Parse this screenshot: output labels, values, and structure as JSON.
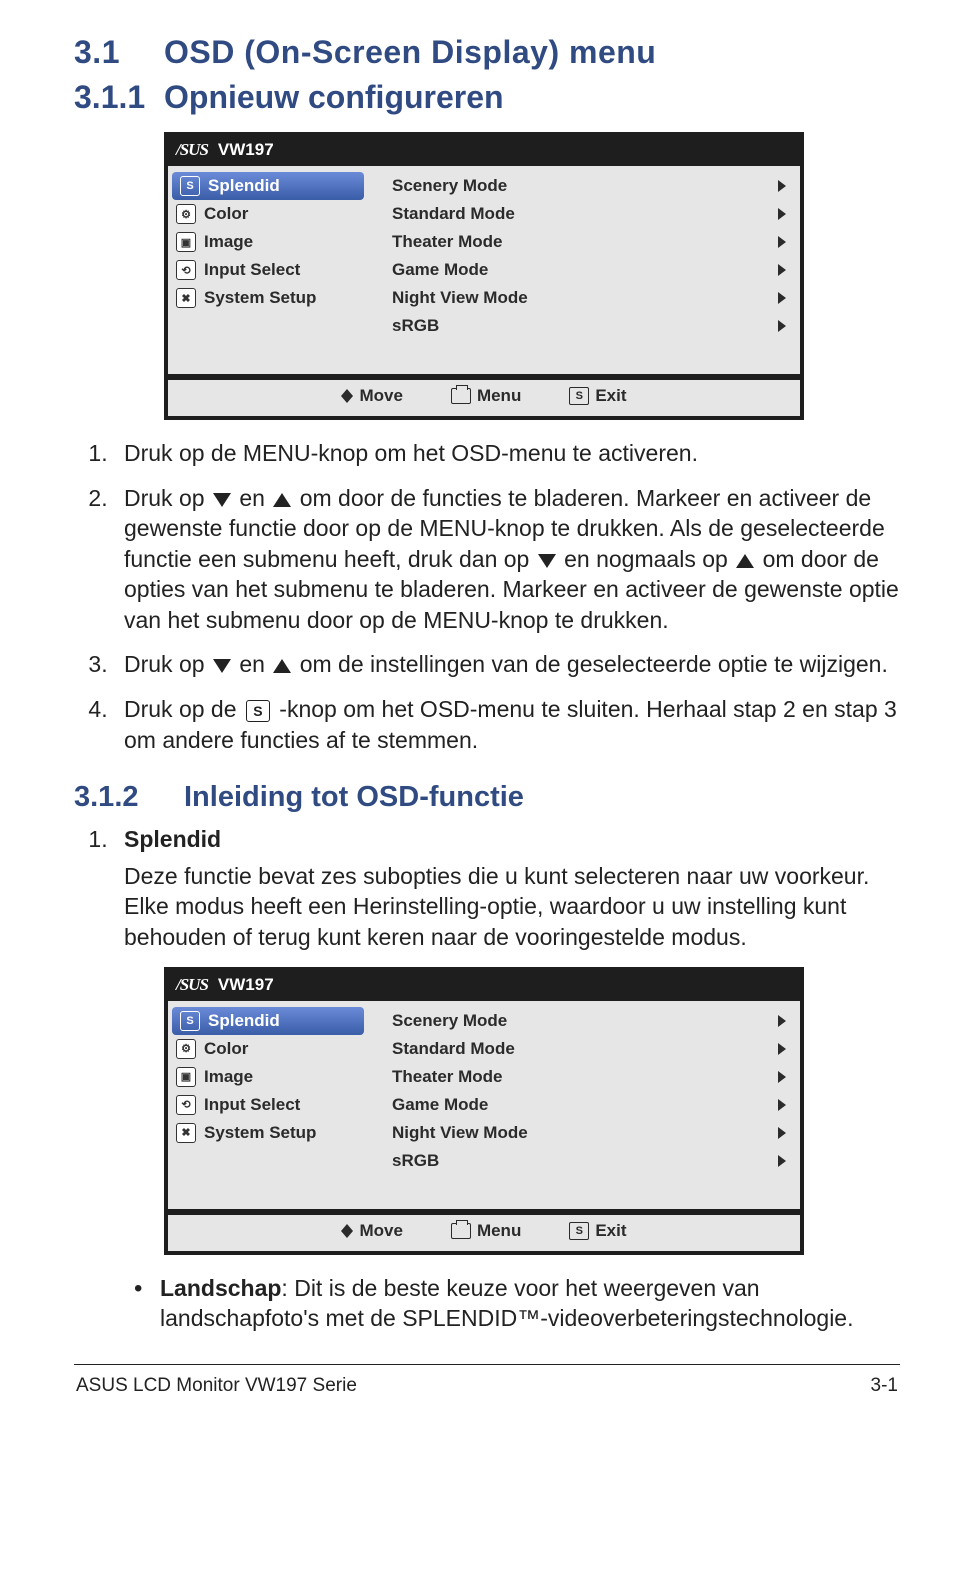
{
  "headings": {
    "h31_num": "3.1",
    "h31_title": "OSD (On-Screen Display) menu",
    "h311_num": "3.1.1",
    "h311_title": "Opnieuw configureren",
    "h312_num": "3.1.2",
    "h312_title": "Inleiding tot OSD-functie"
  },
  "osd": {
    "brand": "/SUS",
    "model": "VW197",
    "leftItems": [
      {
        "icon": "S",
        "label": "Splendid"
      },
      {
        "icon": "⚙",
        "label": "Color"
      },
      {
        "icon": "▣",
        "label": "Image"
      },
      {
        "icon": "⟲",
        "label": "Input Select"
      },
      {
        "icon": "✖",
        "label": "System Setup"
      }
    ],
    "modes": [
      "Scenery Mode",
      "Standard Mode",
      "Theater Mode",
      "Game Mode",
      "Night View Mode",
      "sRGB"
    ],
    "bottom": {
      "move": "Move",
      "menu": "Menu",
      "exit": "Exit"
    }
  },
  "steps": {
    "s1": "Druk op de MENU-knop om het OSD-menu te activeren.",
    "s2a": "Druk op ",
    "s2b": " en ",
    "s2c": " om door de functies te bladeren. Markeer en activeer de gewenste functie door op de MENU-knop te drukken. Als de geselecteerde functie een submenu heeft, druk dan op ",
    "s2d": " en nogmaals op ",
    "s2e": " om door de opties van het submenu te bladeren. Markeer en activeer de gewenste optie van het submenu door op de MENU-knop te drukken.",
    "s3a": "Druk op ",
    "s3b": " en ",
    "s3c": " om de instellingen van de geselecteerde optie te wijzigen.",
    "s4a": "Druk op de ",
    "s4b": " -knop om het OSD-menu te sluiten. Herhaal stap 2 en stap 3 om andere functies af te stemmen.",
    "s_icon": "S"
  },
  "splendid": {
    "title": "Splendid",
    "body": "Deze functie bevat zes subopties die u kunt selecteren naar uw voorkeur. Elke modus heeft een Herinstelling-optie, waardoor u uw instelling kunt behouden of terug kunt keren naar de vooringestelde modus."
  },
  "bullet": {
    "name": "Landschap",
    "sep": ": ",
    "text": "Dit is de beste keuze voor het weergeven van landschapfoto's met de SPLENDID™-videoverbeteringstechnologie."
  },
  "footer": {
    "left": "ASUS LCD Monitor VW197 Serie",
    "right": "3-1"
  }
}
